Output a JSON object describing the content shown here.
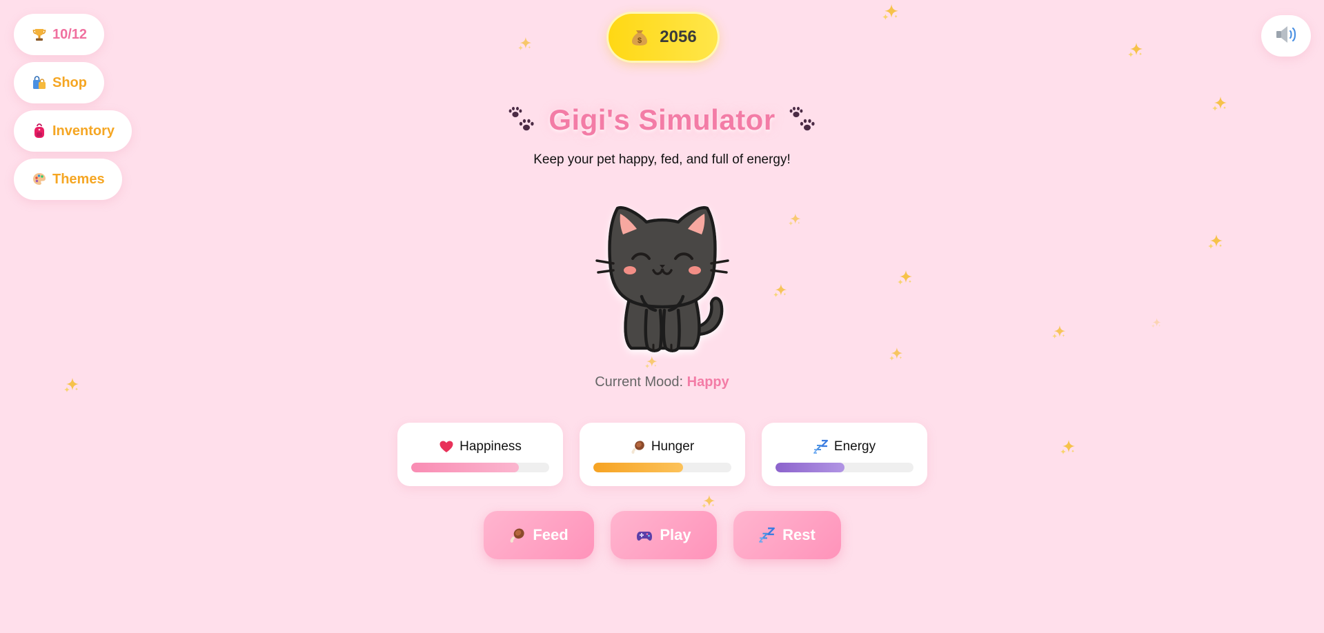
{
  "nav": {
    "trophy_label": "10/12",
    "shop_label": "Shop",
    "inventory_label": "Inventory",
    "themes_label": "Themes"
  },
  "coins": "2056",
  "title": "Gigi's Simulator",
  "subtitle": "Keep your pet happy, fed, and full of energy!",
  "mood": {
    "label": "Current Mood:",
    "value": "Happy"
  },
  "stats": {
    "happiness": {
      "label": "Happiness",
      "level": 0.78,
      "color_start": "#f98cb3",
      "color_end": "#fbb6cf"
    },
    "hunger": {
      "label": "Hunger",
      "level": 0.65,
      "color_start": "#f6a323",
      "color_end": "#fcc25a"
    },
    "energy": {
      "label": "Energy",
      "level": 0.5,
      "color_start": "#8c63cc",
      "color_end": "#b195e4"
    }
  },
  "actions": {
    "feed_label": "Feed",
    "play_label": "Play",
    "rest_label": "Rest"
  },
  "icons": {
    "trophy": "trophy-icon",
    "shop": "shopping-bags-icon",
    "inventory": "backpack-icon",
    "themes": "palette-icon",
    "coins": "money-bag-icon",
    "sound": "speaker-icon",
    "paw": "paw-prints-icon",
    "happiness": "heart-icon",
    "hunger": "meat-icon",
    "energy": "zzz-icon",
    "play": "game-controller-icon"
  },
  "colors": {
    "background": "#ffdfeb",
    "title": "#f37ca6",
    "nav_text": "#f5a623",
    "coin_pill": "#ffd814",
    "action_button": "#ff9dc0",
    "cat_body": "#4a4744"
  }
}
